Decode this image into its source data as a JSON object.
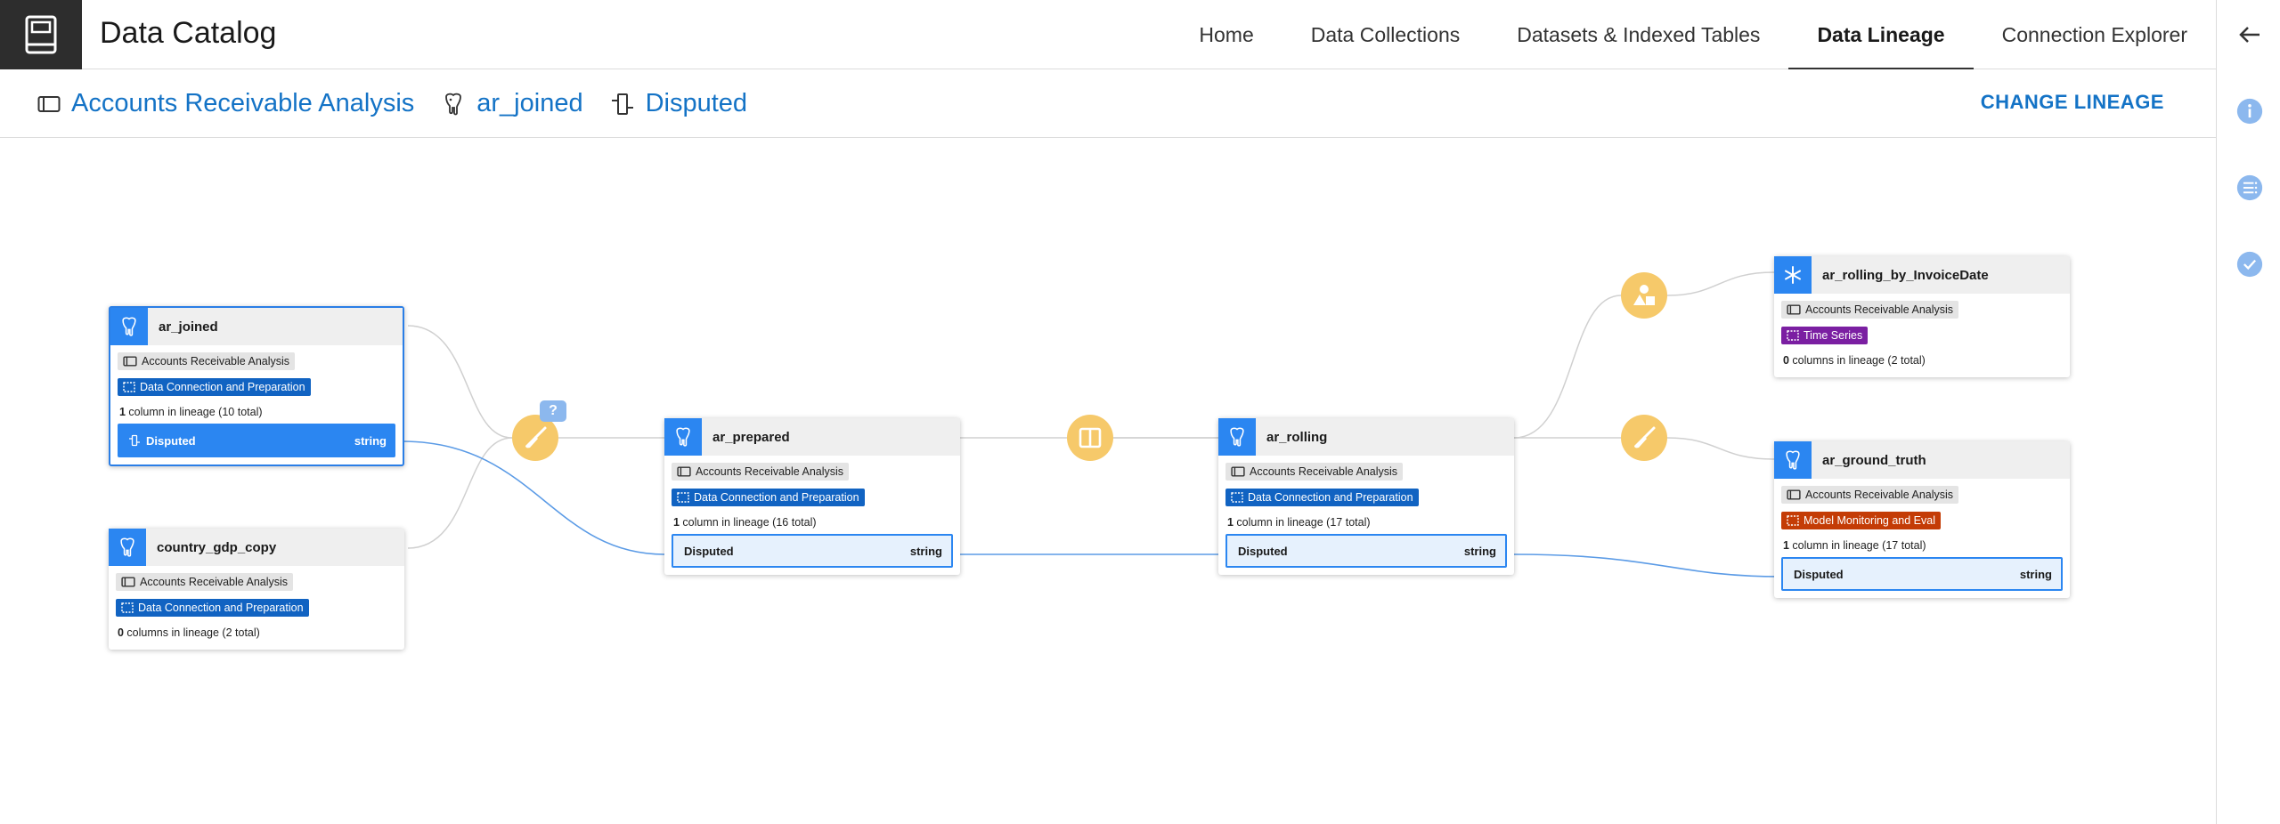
{
  "app": {
    "title": "Data Catalog"
  },
  "nav": [
    {
      "label": "Home",
      "active": false
    },
    {
      "label": "Data Collections",
      "active": false
    },
    {
      "label": "Datasets & Indexed Tables",
      "active": false
    },
    {
      "label": "Data Lineage",
      "active": true
    },
    {
      "label": "Connection Explorer",
      "active": false
    }
  ],
  "breadcrumb": {
    "collection": "Accounts Receivable Analysis",
    "dataset": "ar_joined",
    "column": "Disputed"
  },
  "change_lineage_label": "CHANGE LINEAGE",
  "colors": {
    "accent": "#1473c6",
    "node_icon": "#2b86f1",
    "operation": "#f6c96a",
    "edge": "#d0d0d0",
    "edge_active": "#5b9be6"
  },
  "nodes": {
    "ar_joined": {
      "title": "ar_joined",
      "icon": "postgres-icon",
      "collection": "Accounts Receivable Analysis",
      "tag": "Data Connection and Preparation",
      "count_bold": "1",
      "count_text": " column in lineage (10 total)",
      "column": {
        "name": "Disputed",
        "type": "string"
      }
    },
    "country_gdp_copy": {
      "title": "country_gdp_copy",
      "icon": "postgres-icon",
      "collection": "Accounts Receivable Analysis",
      "tag": "Data Connection and Preparation",
      "count_bold": "0",
      "count_text": " columns in lineage (2 total)"
    },
    "ar_prepared": {
      "title": "ar_prepared",
      "icon": "postgres-icon",
      "collection": "Accounts Receivable Analysis",
      "tag": "Data Connection and Preparation",
      "count_bold": "1",
      "count_text": " column in lineage (16 total)",
      "column": {
        "name": "Disputed",
        "type": "string"
      }
    },
    "ar_rolling": {
      "title": "ar_rolling",
      "icon": "postgres-icon",
      "collection": "Accounts Receivable Analysis",
      "tag": "Data Connection and Preparation",
      "count_bold": "1",
      "count_text": " column in lineage (17 total)",
      "column": {
        "name": "Disputed",
        "type": "string"
      }
    },
    "ar_rolling_by_InvoiceDate": {
      "title": "ar_rolling_by_InvoiceDate",
      "icon": "snowflake-icon",
      "collection": "Accounts Receivable Analysis",
      "tag": "Time Series",
      "count_bold": "0",
      "count_text": " columns in lineage (2 total)"
    },
    "ar_ground_truth": {
      "title": "ar_ground_truth",
      "icon": "postgres-icon",
      "collection": "Accounts Receivable Analysis",
      "tag": "Model Monitoring and Eval",
      "count_bold": "1",
      "count_text": " column in lineage (17 total)",
      "column": {
        "name": "Disputed",
        "type": "string"
      }
    }
  },
  "operations": {
    "prep_badge": "?"
  }
}
